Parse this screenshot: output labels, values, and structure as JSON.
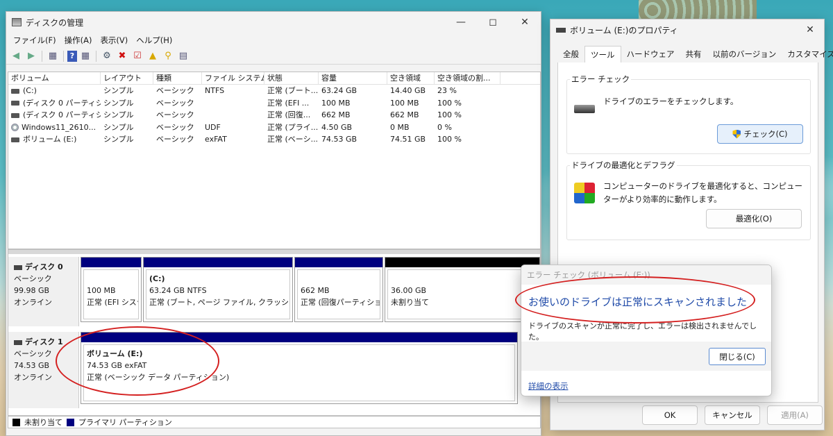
{
  "dm": {
    "title": "ディスクの管理",
    "menu": [
      "ファイル(F)",
      "操作(A)",
      "表示(V)",
      "ヘルプ(H)"
    ],
    "columns": [
      "ボリューム",
      "レイアウト",
      "種類",
      "ファイル システム",
      "状態",
      "容量",
      "空き領域",
      "空き領域の割..."
    ],
    "volumes": [
      {
        "name": "(C:)",
        "layout": "シンプル",
        "type": "ベーシック",
        "fs": "NTFS",
        "status": "正常 (ブート...",
        "capacity": "63.24 GB",
        "free": "14.40 GB",
        "pct": "23 %",
        "icon": "drive-icon"
      },
      {
        "name": "(ディスク 0 パーティショ...",
        "layout": "シンプル",
        "type": "ベーシック",
        "fs": "",
        "status": "正常 (EFI ...",
        "capacity": "100 MB",
        "free": "100 MB",
        "pct": "100 %",
        "icon": "drive-icon"
      },
      {
        "name": "(ディスク 0 パーティショ...",
        "layout": "シンプル",
        "type": "ベーシック",
        "fs": "",
        "status": "正常 (回復...",
        "capacity": "662 MB",
        "free": "662 MB",
        "pct": "100 %",
        "icon": "drive-icon"
      },
      {
        "name": "Windows11_2610...",
        "layout": "シンプル",
        "type": "ベーシック",
        "fs": "UDF",
        "status": "正常 (プライ...",
        "capacity": "4.50 GB",
        "free": "0 MB",
        "pct": "0 %",
        "icon": "cd-icon"
      },
      {
        "name": "ボリューム (E:)",
        "layout": "シンプル",
        "type": "ベーシック",
        "fs": "exFAT",
        "status": "正常 (ベーシ...",
        "capacity": "74.53 GB",
        "free": "74.51 GB",
        "pct": "100 %",
        "icon": "drive-icon"
      }
    ],
    "disk0": {
      "name": "ディスク 0",
      "type": "ベーシック",
      "size": "99.98 GB",
      "state": "オンライン",
      "parts": [
        {
          "title": "",
          "size": "100 MB",
          "status": "正常 (EFI システ"
        },
        {
          "title": "(C:)",
          "size": "63.24 GB NTFS",
          "status": "正常 (ブート, ページ ファイル, クラッシュ ダンプ"
        },
        {
          "title": "",
          "size": "662 MB",
          "status": "正常 (回復パーティション"
        },
        {
          "title": "",
          "size": "36.00 GB",
          "status": "未割り当て"
        }
      ]
    },
    "disk1": {
      "name": "ディスク 1",
      "type": "ベーシック",
      "size": "74.53 GB",
      "state": "オンライン",
      "part": {
        "title": "ボリューム (E:)",
        "size": "74.53 GB exFAT",
        "status": "正常 (ベーシック データ パーティション)"
      }
    },
    "legend": {
      "unallocated": "未割り当て",
      "primary": "プライマリ パーティション"
    },
    "colors": {
      "primary": "#00007f",
      "unallocated": "#000000"
    }
  },
  "props": {
    "title": "ボリューム (E:)のプロパティ",
    "tabs": [
      "全般",
      "ツール",
      "ハードウェア",
      "共有",
      "以前のバージョン",
      "カスタマイズ"
    ],
    "active_tab": "ツール",
    "errcheck": {
      "title": "エラー チェック",
      "desc": "ドライブのエラーをチェックします。",
      "button": "チェック(C)"
    },
    "defrag": {
      "title": "ドライブの最適化とデフラグ",
      "desc": "コンピューターのドライブを最適化すると、コンピューターがより効率的に動作します。",
      "button": "最適化(O)"
    },
    "ok": "OK",
    "cancel": "キャンセル",
    "apply": "適用(A)"
  },
  "ecdialog": {
    "title": "エラー チェック (ボリューム (E:))",
    "heading": "お使いのドライブは正常にスキャンされました",
    "message": "ドライブのスキャンが正常に完了し、エラーは検出されませんでした。",
    "close": "閉じる(C)",
    "details": "詳細の表示"
  }
}
